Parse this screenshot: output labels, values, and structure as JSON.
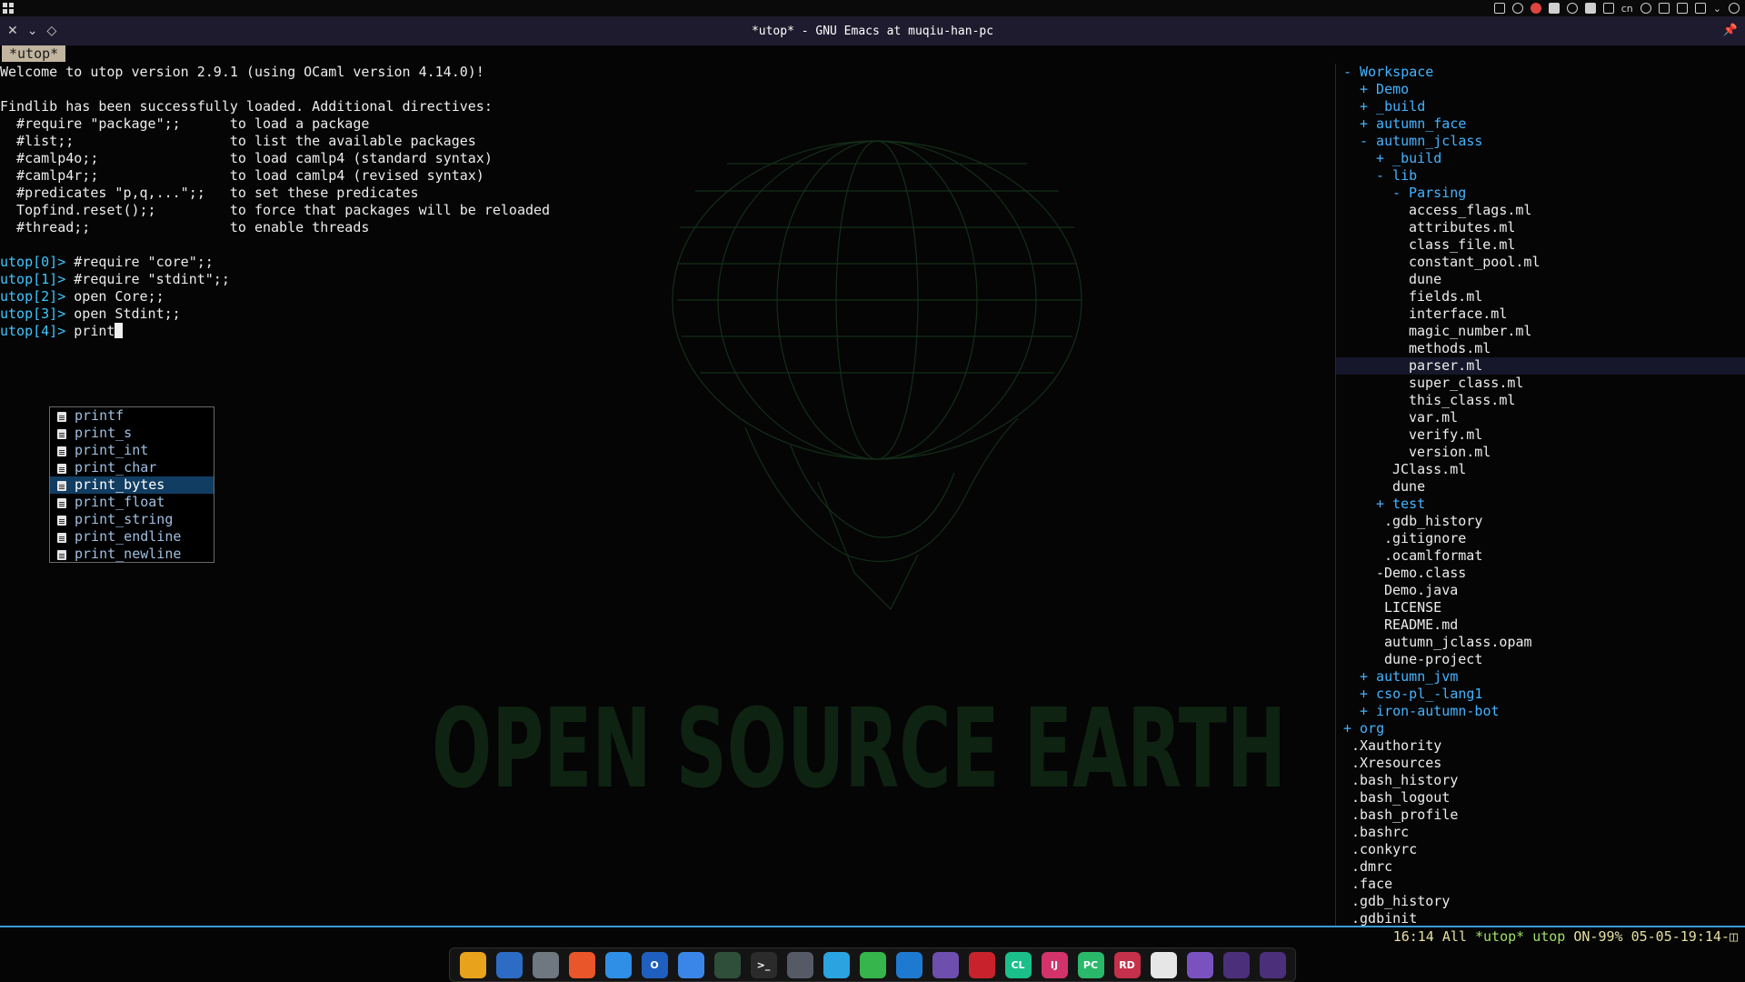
{
  "window": {
    "title": "*utop* - GNU Emacs at muqiu-han-pc"
  },
  "tray": {
    "lang": "cn"
  },
  "tab": {
    "label": "*utop*"
  },
  "buffer": {
    "lines": [
      {
        "text": "Welcome to utop version 2.9.1 (using OCaml version 4.14.0)!"
      },
      {
        "text": ""
      },
      {
        "text": "Findlib has been successfully loaded. Additional directives:"
      },
      {
        "text": "  #require \"package\";;      to load a package"
      },
      {
        "text": "  #list;;                   to list the available packages"
      },
      {
        "text": "  #camlp4o;;                to load camlp4 (standard syntax)"
      },
      {
        "text": "  #camlp4r;;                to load camlp4 (revised syntax)"
      },
      {
        "text": "  #predicates \"p,q,...\";;   to set these predicates"
      },
      {
        "text": "  Topfind.reset();;         to force that packages will be reloaded"
      },
      {
        "text": "  #thread;;                 to enable threads"
      },
      {
        "text": ""
      },
      {
        "prompt": "utop[0]>",
        "text": " #require \"core\";;"
      },
      {
        "prompt": "utop[1]>",
        "text": " #require \"stdint\";;"
      },
      {
        "prompt": "utop[2]>",
        "text": " open Core;;"
      },
      {
        "prompt": "utop[3]>",
        "text": " open Stdint;;"
      }
    ],
    "current": {
      "prompt": "utop[4]>",
      "text": " print"
    },
    "wallpaper_text": "OPEN SOURCE EARTH"
  },
  "completion": {
    "items": [
      "printf",
      "print_s",
      "print_int",
      "print_char",
      "print_bytes",
      "print_float",
      "print_string",
      "print_endline",
      "print_newline"
    ],
    "selected": "print_bytes"
  },
  "tree": {
    "rows": [
      {
        "text": "- Workspace",
        "depth": 1,
        "kind": "dir"
      },
      {
        "text": "+ Demo",
        "depth": 2,
        "kind": "dir"
      },
      {
        "text": "+ _build",
        "depth": 2,
        "kind": "dir"
      },
      {
        "text": "+ autumn_face",
        "depth": 2,
        "kind": "dir"
      },
      {
        "text": "- autumn_jclass",
        "depth": 2,
        "kind": "dir"
      },
      {
        "text": "+ _build",
        "depth": 3,
        "kind": "dir"
      },
      {
        "text": "- lib",
        "depth": 3,
        "kind": "dir"
      },
      {
        "text": "- Parsing",
        "depth": 4,
        "kind": "dir"
      },
      {
        "text": "access_flags.ml",
        "depth": 5,
        "kind": "file"
      },
      {
        "text": "attributes.ml",
        "depth": 5,
        "kind": "file"
      },
      {
        "text": "class_file.ml",
        "depth": 5,
        "kind": "file"
      },
      {
        "text": "constant_pool.ml",
        "depth": 5,
        "kind": "file"
      },
      {
        "text": "dune",
        "depth": 5,
        "kind": "file"
      },
      {
        "text": "fields.ml",
        "depth": 5,
        "kind": "file"
      },
      {
        "text": "interface.ml",
        "depth": 5,
        "kind": "file"
      },
      {
        "text": "magic_number.ml",
        "depth": 5,
        "kind": "file"
      },
      {
        "text": "methods.ml",
        "depth": 5,
        "kind": "file"
      },
      {
        "text": "parser.ml",
        "depth": 5,
        "kind": "file",
        "highlight": true
      },
      {
        "text": "super_class.ml",
        "depth": 5,
        "kind": "file"
      },
      {
        "text": "this_class.ml",
        "depth": 5,
        "kind": "file"
      },
      {
        "text": "var.ml",
        "depth": 5,
        "kind": "file"
      },
      {
        "text": "verify.ml",
        "depth": 5,
        "kind": "file"
      },
      {
        "text": "version.ml",
        "depth": 5,
        "kind": "file"
      },
      {
        "text": "JClass.ml",
        "depth": 4,
        "kind": "file"
      },
      {
        "text": "dune",
        "depth": 4,
        "kind": "file"
      },
      {
        "text": "+ test",
        "depth": 3,
        "kind": "dir"
      },
      {
        "text": ".gdb_history",
        "depth": 3.5,
        "kind": "file"
      },
      {
        "text": ".gitignore",
        "depth": 3.5,
        "kind": "file"
      },
      {
        "text": ".ocamlformat",
        "depth": 3.5,
        "kind": "file"
      },
      {
        "text": "-Demo.class",
        "depth": 3,
        "kind": "file"
      },
      {
        "text": "Demo.java",
        "depth": 3.5,
        "kind": "file"
      },
      {
        "text": "LICENSE",
        "depth": 3.5,
        "kind": "file"
      },
      {
        "text": "README.md",
        "depth": 3.5,
        "kind": "file"
      },
      {
        "text": "autumn_jclass.opam",
        "depth": 3.5,
        "kind": "file"
      },
      {
        "text": "dune-project",
        "depth": 3.5,
        "kind": "file"
      },
      {
        "text": "+ autumn_jvm",
        "depth": 2,
        "kind": "dir"
      },
      {
        "text": "+ cso-pl_-lang1",
        "depth": 2,
        "kind": "dir"
      },
      {
        "text": "+ iron-autumn-bot",
        "depth": 2,
        "kind": "dir"
      },
      {
        "text": "+ org",
        "depth": 1,
        "kind": "dir"
      },
      {
        "text": ".Xauthority",
        "depth": 1.5,
        "kind": "file"
      },
      {
        "text": ".Xresources",
        "depth": 1.5,
        "kind": "file"
      },
      {
        "text": ".bash_history",
        "depth": 1.5,
        "kind": "file"
      },
      {
        "text": ".bash_logout",
        "depth": 1.5,
        "kind": "file"
      },
      {
        "text": ".bash_profile",
        "depth": 1.5,
        "kind": "file"
      },
      {
        "text": ".bashrc",
        "depth": 1.5,
        "kind": "file"
      },
      {
        "text": ".conkyrc",
        "depth": 1.5,
        "kind": "file"
      },
      {
        "text": ".dmrc",
        "depth": 1.5,
        "kind": "file"
      },
      {
        "text": ".face",
        "depth": 1.5,
        "kind": "file"
      },
      {
        "text": ".gdb_history",
        "depth": 1.5,
        "kind": "file"
      },
      {
        "text": ".gdbinit",
        "depth": 1.5,
        "kind": "file"
      }
    ]
  },
  "modeline": {
    "position": "16:14",
    "scope": "All",
    "buffer": "*utop*",
    "mode": "utop",
    "battery": "ON-99%",
    "datetime": "05-05-19:14-"
  },
  "dock": {
    "apps": [
      {
        "name": "files-icon",
        "color": "#e8a21c",
        "glyph": ""
      },
      {
        "name": "store-icon",
        "color": "#2d6cc5",
        "glyph": ""
      },
      {
        "name": "settings-icon",
        "color": "#6f7780",
        "glyph": ""
      },
      {
        "name": "firefox-icon",
        "color": "#e8562a",
        "glyph": ""
      },
      {
        "name": "notes-icon",
        "color": "#2f8fe6",
        "glyph": ""
      },
      {
        "name": "outlook-icon",
        "color": "#1f5fbf",
        "glyph": "O"
      },
      {
        "name": "mail-icon",
        "color": "#3a86e8",
        "glyph": ""
      },
      {
        "name": "monitor-icon",
        "color": "#2f4f3a",
        "glyph": ""
      },
      {
        "name": "terminal-icon",
        "color": "#2b2b2b",
        "glyph": ">_"
      },
      {
        "name": "gpg-icon",
        "color": "#555a66",
        "glyph": ""
      },
      {
        "name": "telegram-icon",
        "color": "#2aa3e0",
        "glyph": ""
      },
      {
        "name": "wechat-icon",
        "color": "#35b54b",
        "glyph": ""
      },
      {
        "name": "vscode-icon",
        "color": "#1e7ad1",
        "glyph": ""
      },
      {
        "name": "emacs-icon",
        "color": "#6e4fae",
        "glyph": ""
      },
      {
        "name": "app-red-icon",
        "color": "#c8232c",
        "glyph": ""
      },
      {
        "name": "clion-icon",
        "color": "#1bbf8a",
        "glyph": "CL"
      },
      {
        "name": "intellij-icon",
        "color": "#d1336a",
        "glyph": "IJ"
      },
      {
        "name": "pycharm-icon",
        "color": "#2ab86a",
        "glyph": "PC"
      },
      {
        "name": "rider-icon",
        "color": "#c5304a",
        "glyph": "RD"
      },
      {
        "name": "player-icon",
        "color": "#e6e6e6",
        "glyph": ""
      },
      {
        "name": "emacs-icon-2",
        "color": "#7a52c0",
        "glyph": ""
      },
      {
        "name": "cpu-meter-icon",
        "color": "#4b2f7a",
        "glyph": ""
      },
      {
        "name": "mem-meter-icon",
        "color": "#4b2f7a",
        "glyph": ""
      }
    ]
  }
}
